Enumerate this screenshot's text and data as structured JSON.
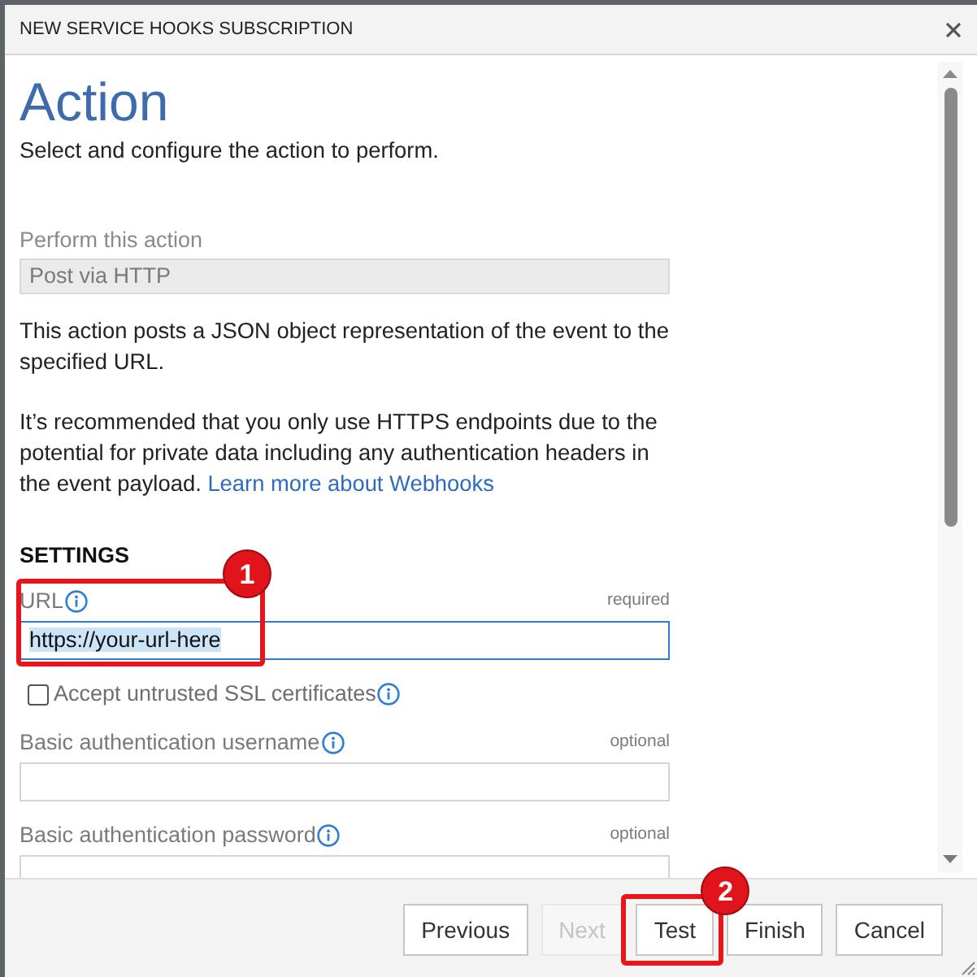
{
  "window": {
    "title": "NEW SERVICE HOOKS SUBSCRIPTION"
  },
  "page": {
    "heading": "Action",
    "subtitle": "Select and configure the action to perform."
  },
  "action_field": {
    "label": "Perform this action",
    "value": "Post via HTTP",
    "disabled": true
  },
  "paragraphs": [
    {
      "text": "This action posts a JSON object representation of the event to the specified URL."
    },
    {
      "text": "It’s recommended that you only use HTTPS endpoints due to the potential for private data including any authentication headers in the event payload.",
      "link": "Learn more about Webhooks"
    }
  ],
  "settings": {
    "heading": "SETTINGS",
    "fields": [
      {
        "kind": "text",
        "label": "URL",
        "info": true,
        "note": "required",
        "value": "https://your-url-here",
        "focused": true,
        "value_selected": true,
        "callout": "1"
      },
      {
        "kind": "checkbox",
        "label": "Accept untrusted SSL certificates",
        "info": true,
        "checked": false
      },
      {
        "kind": "text",
        "label": "Basic authentication username",
        "info": true,
        "note": "optional",
        "focused": false
      },
      {
        "kind": "text",
        "label": "Basic authentication password",
        "info": true,
        "note": "optional",
        "focused": false
      }
    ]
  },
  "buttons": [
    {
      "label": "Previous",
      "disabled": false
    },
    {
      "label": "Next",
      "disabled": true
    },
    {
      "label": "Test",
      "disabled": false,
      "callout": "2"
    },
    {
      "label": "Finish",
      "disabled": false
    },
    {
      "label": "Cancel",
      "disabled": false
    }
  ]
}
